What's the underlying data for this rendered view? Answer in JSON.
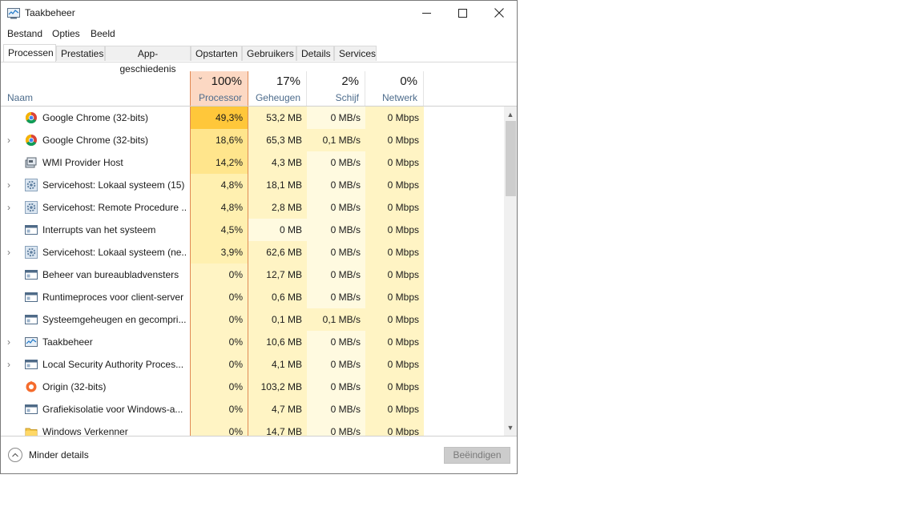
{
  "window": {
    "title": "Taakbeheer"
  },
  "menu": [
    "Bestand",
    "Opties",
    "Beeld"
  ],
  "tabs": [
    "Processen",
    "Prestaties",
    "App-geschiedenis",
    "Opstarten",
    "Gebruikers",
    "Details",
    "Services"
  ],
  "columns": {
    "name": {
      "label": "Naam"
    },
    "cpu": {
      "percent": "100%",
      "label": "Processor"
    },
    "mem": {
      "percent": "17%",
      "label": "Geheugen"
    },
    "disk": {
      "percent": "2%",
      "label": "Schijf"
    },
    "net": {
      "percent": "0%",
      "label": "Netwerk"
    }
  },
  "processes": [
    {
      "name": "Google Chrome (32-bits)",
      "cpu": "49,3%",
      "mem": "53,2 MB",
      "disk": "0 MB/s",
      "net": "0 Mbps",
      "expandable": false,
      "icon": "chrome-icon"
    },
    {
      "name": "Google Chrome (32-bits)",
      "cpu": "18,6%",
      "mem": "65,3 MB",
      "disk": "0,1 MB/s",
      "net": "0 Mbps",
      "expandable": true,
      "icon": "chrome-icon"
    },
    {
      "name": "WMI Provider Host",
      "cpu": "14,2%",
      "mem": "4,3 MB",
      "disk": "0 MB/s",
      "net": "0 Mbps",
      "expandable": false,
      "icon": "wmi-icon"
    },
    {
      "name": "Servicehost: Lokaal systeem (15)",
      "cpu": "4,8%",
      "mem": "18,1 MB",
      "disk": "0 MB/s",
      "net": "0 Mbps",
      "expandable": true,
      "icon": "gear-icon"
    },
    {
      "name": "Servicehost: Remote Procedure ...",
      "cpu": "4,8%",
      "mem": "2,8 MB",
      "disk": "0 MB/s",
      "net": "0 Mbps",
      "expandable": true,
      "icon": "gear-icon"
    },
    {
      "name": "Interrupts van het systeem",
      "cpu": "4,5%",
      "mem": "0 MB",
      "disk": "0 MB/s",
      "net": "0 Mbps",
      "expandable": false,
      "icon": "system-window-icon"
    },
    {
      "name": "Servicehost: Lokaal systeem (ne...",
      "cpu": "3,9%",
      "mem": "62,6 MB",
      "disk": "0 MB/s",
      "net": "0 Mbps",
      "expandable": true,
      "icon": "gear-icon"
    },
    {
      "name": "Beheer van bureaubladvensters",
      "cpu": "0%",
      "mem": "12,7 MB",
      "disk": "0 MB/s",
      "net": "0 Mbps",
      "expandable": false,
      "icon": "system-window-icon"
    },
    {
      "name": "Runtimeproces voor client-server",
      "cpu": "0%",
      "mem": "0,6 MB",
      "disk": "0 MB/s",
      "net": "0 Mbps",
      "expandable": false,
      "icon": "system-window-icon"
    },
    {
      "name": "Systeemgeheugen en gecompri...",
      "cpu": "0%",
      "mem": "0,1 MB",
      "disk": "0,1 MB/s",
      "net": "0 Mbps",
      "expandable": false,
      "icon": "system-window-icon"
    },
    {
      "name": "Taakbeheer",
      "cpu": "0%",
      "mem": "10,6 MB",
      "disk": "0 MB/s",
      "net": "0 Mbps",
      "expandable": true,
      "icon": "taskmanager-icon"
    },
    {
      "name": "Local Security Authority Proces...",
      "cpu": "0%",
      "mem": "4,1 MB",
      "disk": "0 MB/s",
      "net": "0 Mbps",
      "expandable": true,
      "icon": "system-window-icon"
    },
    {
      "name": "Origin (32-bits)",
      "cpu": "0%",
      "mem": "103,2 MB",
      "disk": "0 MB/s",
      "net": "0 Mbps",
      "expandable": false,
      "icon": "origin-icon"
    },
    {
      "name": "Grafiekisolatie voor Windows-a...",
      "cpu": "0%",
      "mem": "4,7 MB",
      "disk": "0 MB/s",
      "net": "0 Mbps",
      "expandable": false,
      "icon": "system-window-icon"
    },
    {
      "name": "Windows Verkenner",
      "cpu": "0%",
      "mem": "14,7 MB",
      "disk": "0 MB/s",
      "net": "0 Mbps",
      "expandable": false,
      "icon": "folder-icon"
    }
  ],
  "footer": {
    "less_details": "Minder details",
    "end_task": "Beëindigen"
  },
  "colors": {
    "cpu_header_bg": "#fcd8c3",
    "cpu_header_border": "#e08a55",
    "heat_strong": "#ffc73a",
    "heat_medium": "#ffe58c",
    "heat_light": "#fff0b0",
    "heat_faint": "#fff4c4",
    "heat_empty": "#fffae0"
  }
}
